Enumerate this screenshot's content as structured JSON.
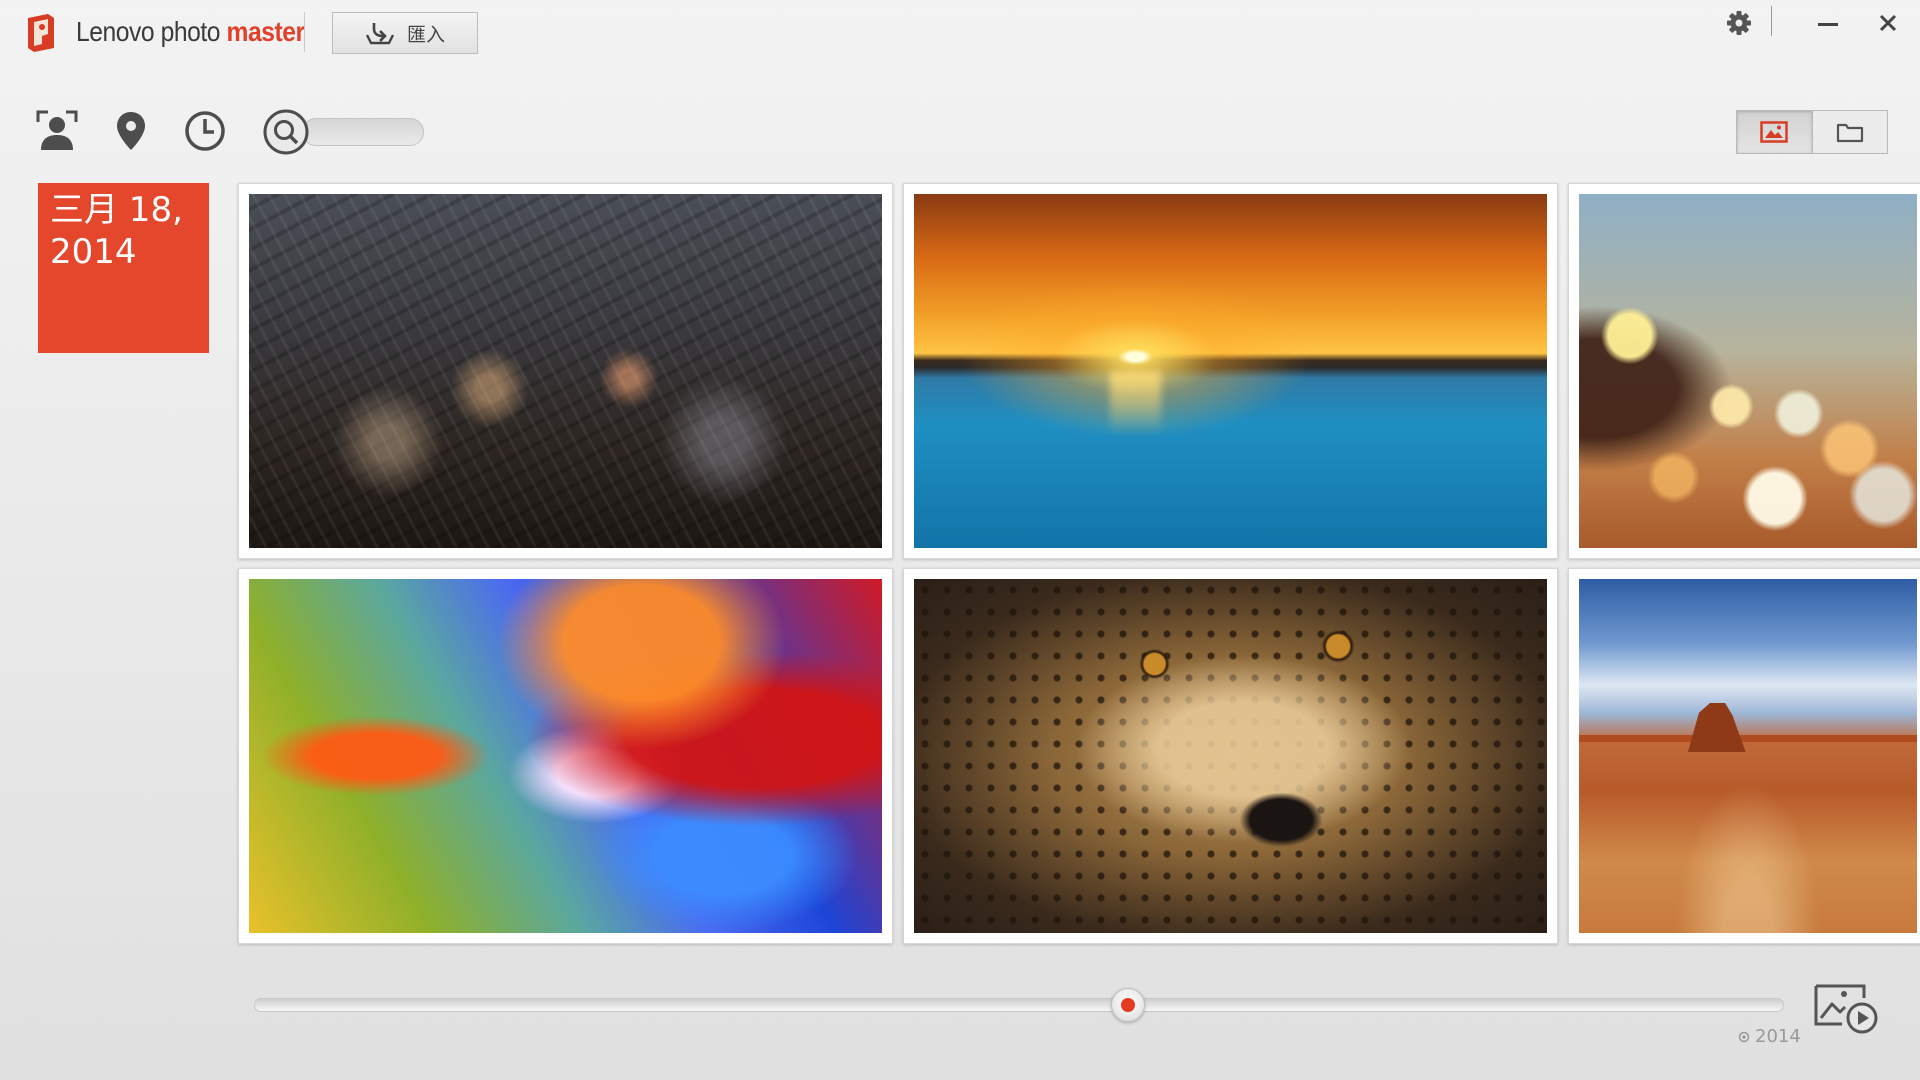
{
  "app": {
    "name_part1": "Lenovo photo ",
    "name_part2": "master",
    "accent_color": "#e0412a"
  },
  "titlebar": {
    "import_label": "匯入",
    "icons": [
      "settings-icon",
      "minimize-icon",
      "close-icon"
    ]
  },
  "toolbar": {
    "icons": [
      "people-icon",
      "location-pin-icon",
      "clock-icon",
      "search-icon"
    ],
    "search": {
      "value": "",
      "placeholder": ""
    },
    "view_modes": [
      "photo-view-icon",
      "folder-view-icon"
    ],
    "active_view": "photo-view-icon"
  },
  "date_group": {
    "line1": "三月 18,",
    "line2": "2014",
    "color": "#e4472c"
  },
  "photos": [
    {
      "name": "photo-city-night",
      "subject": "city"
    },
    {
      "name": "photo-sunset-lake",
      "subject": "sunset"
    },
    {
      "name": "photo-bokeh-lights",
      "subject": "bokeh"
    },
    {
      "name": "photo-flower-macro",
      "subject": "flower"
    },
    {
      "name": "photo-cheetah",
      "subject": "cheetah"
    },
    {
      "name": "photo-desert-butte",
      "subject": "desert"
    }
  ],
  "timeline": {
    "position_fraction": 0.571,
    "year_label": "2014",
    "knob_color": "#e43a21"
  }
}
